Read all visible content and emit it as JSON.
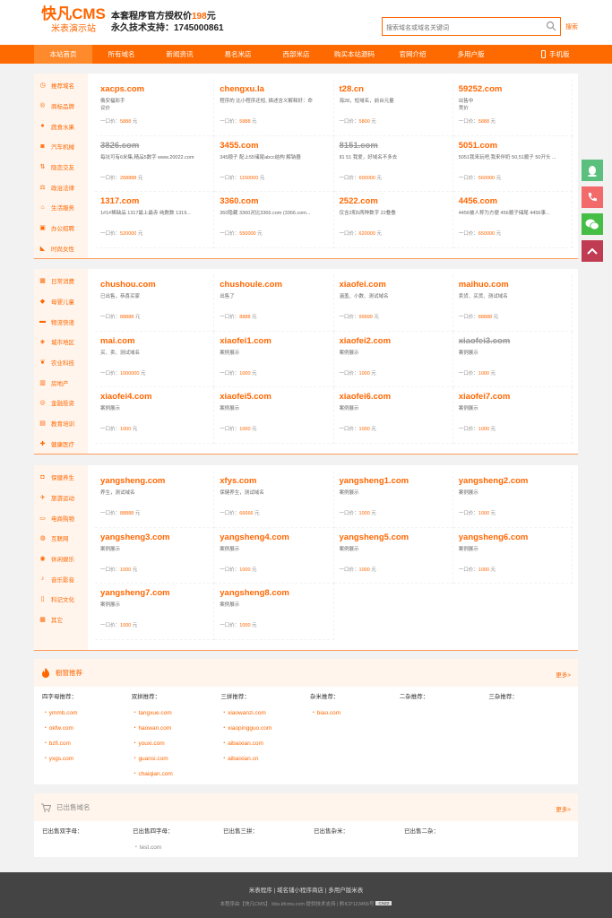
{
  "header": {
    "logo_title": "快凡CMS",
    "logo_subtitle": "米表演示站",
    "auth_text": "本套程序官方授权价",
    "auth_price": "198",
    "auth_unit": "元",
    "support_text": "永久技术支持：1745000861",
    "search_placeholder": "搜索域名或域名关键词",
    "search_button": "搜索"
  },
  "nav": {
    "items": [
      "本站首页",
      "所有域名",
      "新闻资讯",
      "易名米店",
      "西部米店",
      "购买本站源码",
      "官网介绍",
      "多用户版"
    ],
    "mobile": "手机版"
  },
  "colors": {
    "accent": "#ff6600",
    "nav_bg": "#ff6a00",
    "sidebar_bg": "#fff5ec",
    "footer_bg": "#444444"
  },
  "sections": [
    {
      "categories": [
        {
          "icon": "clock-icon",
          "label": "推荐域名"
        },
        {
          "icon": "brand-icon",
          "label": "商标品牌"
        },
        {
          "icon": "apple-icon",
          "label": "蔬食水果"
        },
        {
          "icon": "car-icon",
          "label": "汽车机械"
        },
        {
          "icon": "arrows-icon",
          "label": "隐恋交友"
        },
        {
          "icon": "scale-icon",
          "label": "政治法律"
        },
        {
          "icon": "house-icon",
          "label": "生活服务"
        },
        {
          "icon": "briefcase-icon",
          "label": "办公招聘"
        },
        {
          "icon": "heel-icon",
          "label": "时尚女性"
        }
      ],
      "domains": [
        {
          "name": "xacps.com",
          "desc": "俄安福彩手",
          "desc2": "议价",
          "price": "5888",
          "sold": false
        },
        {
          "name": "chengxu.la",
          "desc": "程序的 比小程序还短, 描述含义解释好：命",
          "desc2": "",
          "price": "5888",
          "sold": false
        },
        {
          "name": "t28.cn",
          "desc": "海28，短域名，前台元量",
          "desc2": "",
          "price": "5800",
          "sold": false
        },
        {
          "name": "59252.com",
          "desc": "出售中",
          "desc2": "竞价",
          "price": "5888",
          "sold": false
        },
        {
          "name": "3826.com",
          "desc": "每坑可有6米集,精品5数字 www.20022.com",
          "desc2": "",
          "price": "268888",
          "sold": true
        },
        {
          "name": "3455.com",
          "desc": "345顺子 配上55储尾abcc结构 解钠器",
          "desc2": "",
          "price": "1150000",
          "sold": false
        },
        {
          "name": "8151.com",
          "desc": "81 51 我爱，好域名不多去",
          "desc2": "",
          "price": "600000",
          "sold": true
        },
        {
          "name": "5051.com",
          "desc": "5051我来玩吧,我来伴奶 50,51顺子 50开头 ...",
          "desc2": "",
          "price": "560000",
          "sold": false
        },
        {
          "name": "1317.com",
          "desc": "1#1#稀缺品 1317最上最赤 纯数数 1319...",
          "desc2": "",
          "price": "520000",
          "sold": false
        },
        {
          "name": "3360.com",
          "desc": "360隐藏 3360对比3366.com (3366.com...",
          "desc2": "",
          "price": "550000",
          "sold": false
        },
        {
          "name": "2522.com",
          "desc": "仅含2和5两种数字 22叠叠",
          "desc2": "",
          "price": "620000",
          "sold": false
        },
        {
          "name": "4456.com",
          "desc": "4456被人称为方便 456顺子储尾 4456事...",
          "desc2": "",
          "price": "650000",
          "sold": false
        }
      ]
    },
    {
      "categories": [
        {
          "icon": "gift-icon",
          "label": "日常消费"
        },
        {
          "icon": "bottle-icon",
          "label": "母婴儿童"
        },
        {
          "icon": "truck-icon",
          "label": "物流快递"
        },
        {
          "icon": "map-icon",
          "label": "城市地区"
        },
        {
          "icon": "leaf-icon",
          "label": "农业科技"
        },
        {
          "icon": "building-icon",
          "label": "房地产"
        },
        {
          "icon": "coins-icon",
          "label": "金融投资"
        },
        {
          "icon": "book-icon",
          "label": "教育培训"
        },
        {
          "icon": "medkit-icon",
          "label": "健康医疗"
        }
      ],
      "domains": [
        {
          "name": "chushou.com",
          "desc": "已出售，恭喜买家",
          "desc2": "",
          "price": "88888",
          "sold": false
        },
        {
          "name": "chushoule.com",
          "desc": "出售了",
          "desc2": "",
          "price": "8888",
          "sold": false
        },
        {
          "name": "xiaofei.com",
          "desc": "涵盖、小数、测试域名",
          "desc2": "",
          "price": "99999",
          "sold": false
        },
        {
          "name": "maihuo.com",
          "desc": "卖货、买货、测试域名",
          "desc2": "",
          "price": "88888",
          "sold": false
        },
        {
          "name": "mai.com",
          "desc": "买、卖、测试域名",
          "desc2": "",
          "price": "1000000",
          "sold": false
        },
        {
          "name": "xiaofei1.com",
          "desc": "案例展示",
          "desc2": "",
          "price": "1000",
          "sold": false
        },
        {
          "name": "xiaofei2.com",
          "desc": "案例展示",
          "desc2": "",
          "price": "1000",
          "sold": false
        },
        {
          "name": "xiaofei3.com",
          "desc": "案例展示",
          "desc2": "",
          "price": "1000",
          "sold": true
        },
        {
          "name": "xiaofei4.com",
          "desc": "案例展示",
          "desc2": "",
          "price": "1000",
          "sold": false
        },
        {
          "name": "xiaofei5.com",
          "desc": "案例展示",
          "desc2": "",
          "price": "1000",
          "sold": false
        },
        {
          "name": "xiaofei6.com",
          "desc": "案例展示",
          "desc2": "",
          "price": "1000",
          "sold": false
        },
        {
          "name": "xiaofei7.com",
          "desc": "案例展示",
          "desc2": "",
          "price": "1000",
          "sold": false
        }
      ]
    },
    {
      "categories": [
        {
          "icon": "cup-icon",
          "label": "保健养生"
        },
        {
          "icon": "runner-icon",
          "label": "旅游运动"
        },
        {
          "icon": "cart-icon",
          "label": "电商购物"
        },
        {
          "icon": "globe-icon",
          "label": "互联网"
        },
        {
          "icon": "game-icon",
          "label": "休闲娱乐"
        },
        {
          "icon": "music-icon",
          "label": "音乐影音"
        },
        {
          "icon": "open-book-icon",
          "label": "科记文化"
        },
        {
          "icon": "grid-icon",
          "label": "其它"
        }
      ],
      "domains": [
        {
          "name": "yangsheng.com",
          "desc": "养生，测试域名",
          "desc2": "",
          "price": "88888",
          "sold": false
        },
        {
          "name": "xfys.com",
          "desc": "保健养生，测试域名",
          "desc2": "",
          "price": "66666",
          "sold": false
        },
        {
          "name": "yangsheng1.com",
          "desc": "案例展示",
          "desc2": "",
          "price": "1000",
          "sold": false
        },
        {
          "name": "yangsheng2.com",
          "desc": "案例展示",
          "desc2": "",
          "price": "1000",
          "sold": false
        },
        {
          "name": "yangsheng3.com",
          "desc": "案例展示",
          "desc2": "",
          "price": "1000",
          "sold": false
        },
        {
          "name": "yangsheng4.com",
          "desc": "案例展示",
          "desc2": "",
          "price": "1000",
          "sold": false
        },
        {
          "name": "yangsheng5.com",
          "desc": "案例展示",
          "desc2": "",
          "price": "1000",
          "sold": false
        },
        {
          "name": "yangsheng6.com",
          "desc": "案例展示",
          "desc2": "",
          "price": "1000",
          "sold": false
        },
        {
          "name": "yangsheng7.com",
          "desc": "案例展示",
          "desc2": "",
          "price": "1000",
          "sold": false
        },
        {
          "name": "yangsheng8.com",
          "desc": "案例展示",
          "desc2": "",
          "price": "1000",
          "sold": false
        }
      ]
    }
  ],
  "price_prefix": "一口价：",
  "price_suffix": "元",
  "recommend": {
    "title": "橱窗推荐",
    "more": "更多>",
    "columns": [
      {
        "title": "四字母推荐：",
        "links": [
          "ymmb.com",
          "okfw.com",
          "bzfi.com",
          "yxgs.com"
        ]
      },
      {
        "title": "双拼推荐：",
        "links": [
          "tangxue.com",
          "haowan.com",
          "youxi.com",
          "guansi.com",
          "chaiqian.com"
        ]
      },
      {
        "title": "三拼推荐：",
        "links": [
          "xiaowanzi.com",
          "xiaopingguo.com",
          "aibaixian.com",
          "aibaixian.cn"
        ]
      },
      {
        "title": "杂米推荐：",
        "links": [
          "biao.com"
        ]
      },
      {
        "title": "二杂推荐：",
        "links": []
      },
      {
        "title": "三杂推荐：",
        "links": []
      }
    ]
  },
  "sold_section": {
    "title": "已出售域名",
    "more": "更多>",
    "columns": [
      {
        "title": "已出售双字母：",
        "links": []
      },
      {
        "title": "已出售四字母：",
        "links": [
          "test.com"
        ]
      },
      {
        "title": "已出售三拼：",
        "links": []
      },
      {
        "title": "已出售杂米：",
        "links": []
      },
      {
        "title": "已出售二杂：",
        "links": []
      }
    ]
  },
  "footer": {
    "links": "米表程序 | 域名铺小程序商店 | 多用户版米表",
    "copyright": "本程序由【快凡CMS】 bbs.kfcms.com 提供技术支持 | 黔ICP123456号",
    "badge": "CNZZ"
  },
  "float_buttons": [
    "qq-icon",
    "phone-icon",
    "wechat-icon",
    "back-to-top-icon"
  ]
}
